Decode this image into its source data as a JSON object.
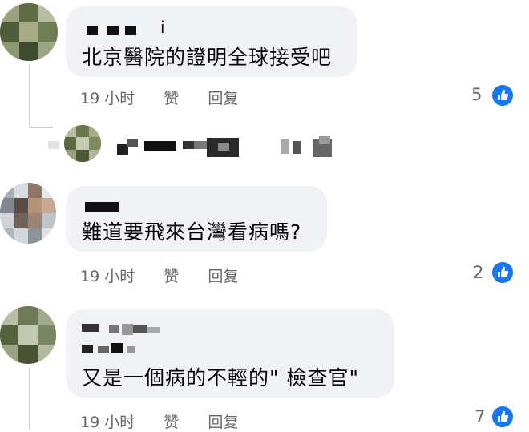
{
  "comments": [
    {
      "text": "北京醫院的證明全球接受吧",
      "time": "19 小时",
      "like_action": "赞",
      "reply_action": "回复",
      "reaction_count": "5",
      "reaction_icon": "thumbs-up-icon",
      "name_fragment": "i"
    },
    {
      "text": "難道要飛來台灣看病嗎?",
      "time": "19 小时",
      "like_action": "赞",
      "reply_action": "回复",
      "reaction_count": "2",
      "reaction_icon": "thumbs-up-icon"
    },
    {
      "text": "又是一個病的不輕的\" 檢查官\"",
      "time": "19 小时",
      "like_action": "赞",
      "reply_action": "回复",
      "reaction_count": "7",
      "reaction_icon": "thumbs-up-icon"
    }
  ],
  "colors": {
    "bubble": "#f0f2f5",
    "meta_text": "#65676b",
    "like_blue": "#1877f2",
    "thread_line": "#ced0d4"
  }
}
